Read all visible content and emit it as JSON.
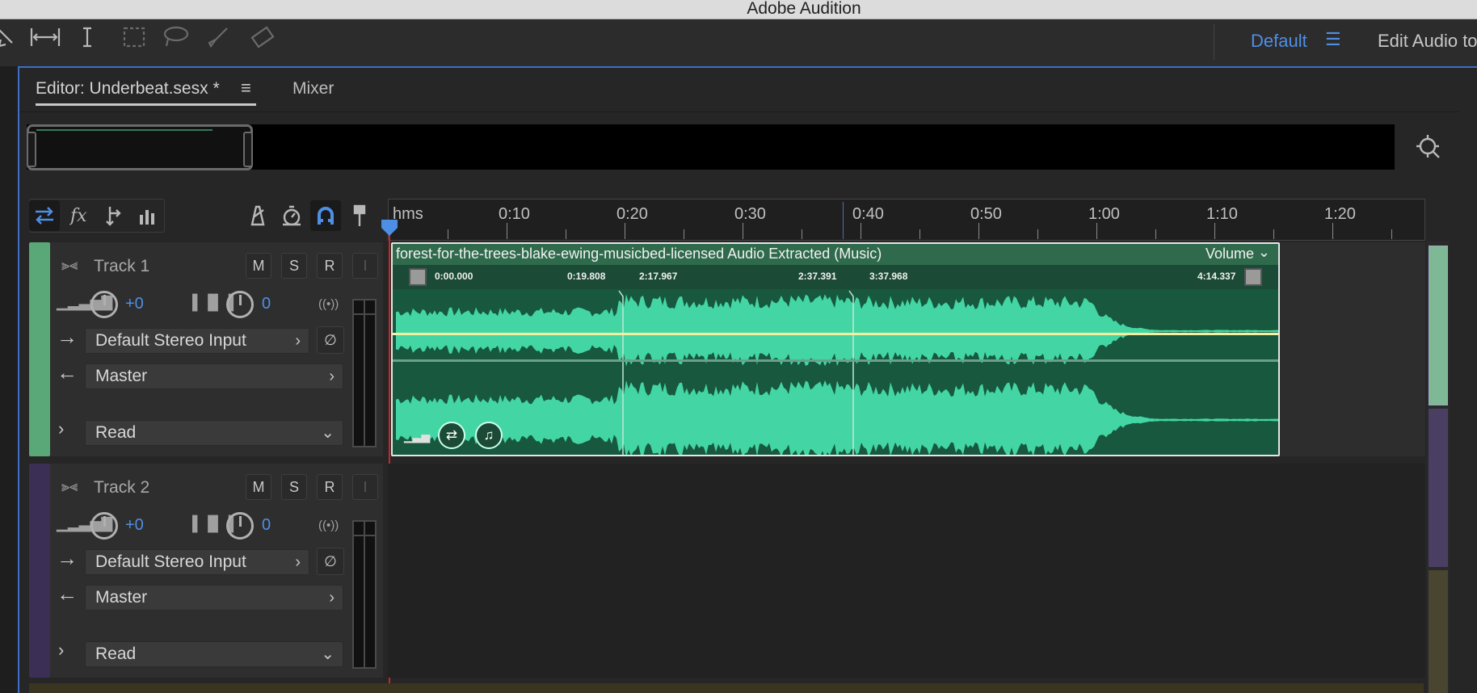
{
  "app": {
    "title": "Adobe Audition"
  },
  "workspace": {
    "current": "Default",
    "menu_icon": "hamburger-icon",
    "other": "Edit Audio to"
  },
  "tools": [
    "move-tool-icon",
    "time-selection-icon",
    "text-cursor-icon",
    "marquee-icon",
    "lasso-icon",
    "brush-icon",
    "spot-healing-icon"
  ],
  "editor": {
    "tab_label": "Editor: Underbeat.sesx *",
    "mixer_label": "Mixer"
  },
  "timeline": {
    "unit_label": "hms",
    "ruler_labels": [
      "0:10",
      "0:20",
      "0:30",
      "0:40",
      "0:50",
      "1:00",
      "1:10",
      "1:20"
    ],
    "playhead_time": 0
  },
  "tracks": [
    {
      "name": "Track 1",
      "color": "#5aa878",
      "m": "M",
      "s": "S",
      "r": "R",
      "i": "I",
      "volume": "+0",
      "pan": "0",
      "input": "Default Stereo Input",
      "output": "Master",
      "automation": "Read"
    },
    {
      "name": "Track 2",
      "color": "#3c2f55",
      "m": "M",
      "s": "S",
      "r": "R",
      "i": "I",
      "volume": "+0",
      "pan": "0",
      "input": "Default Stereo Input",
      "output": "Master",
      "automation": "Read"
    }
  ],
  "clip": {
    "name": "forest-for-the-trees-blake-ewing-musicbed-licensed Audio Extracted (Music)",
    "envelope": "Volume",
    "times": [
      "0:00.000",
      "0:19.808",
      "2:17.967",
      "2:37.391",
      "3:37.968",
      "4:14.337"
    ],
    "color": "#43d6a4"
  }
}
